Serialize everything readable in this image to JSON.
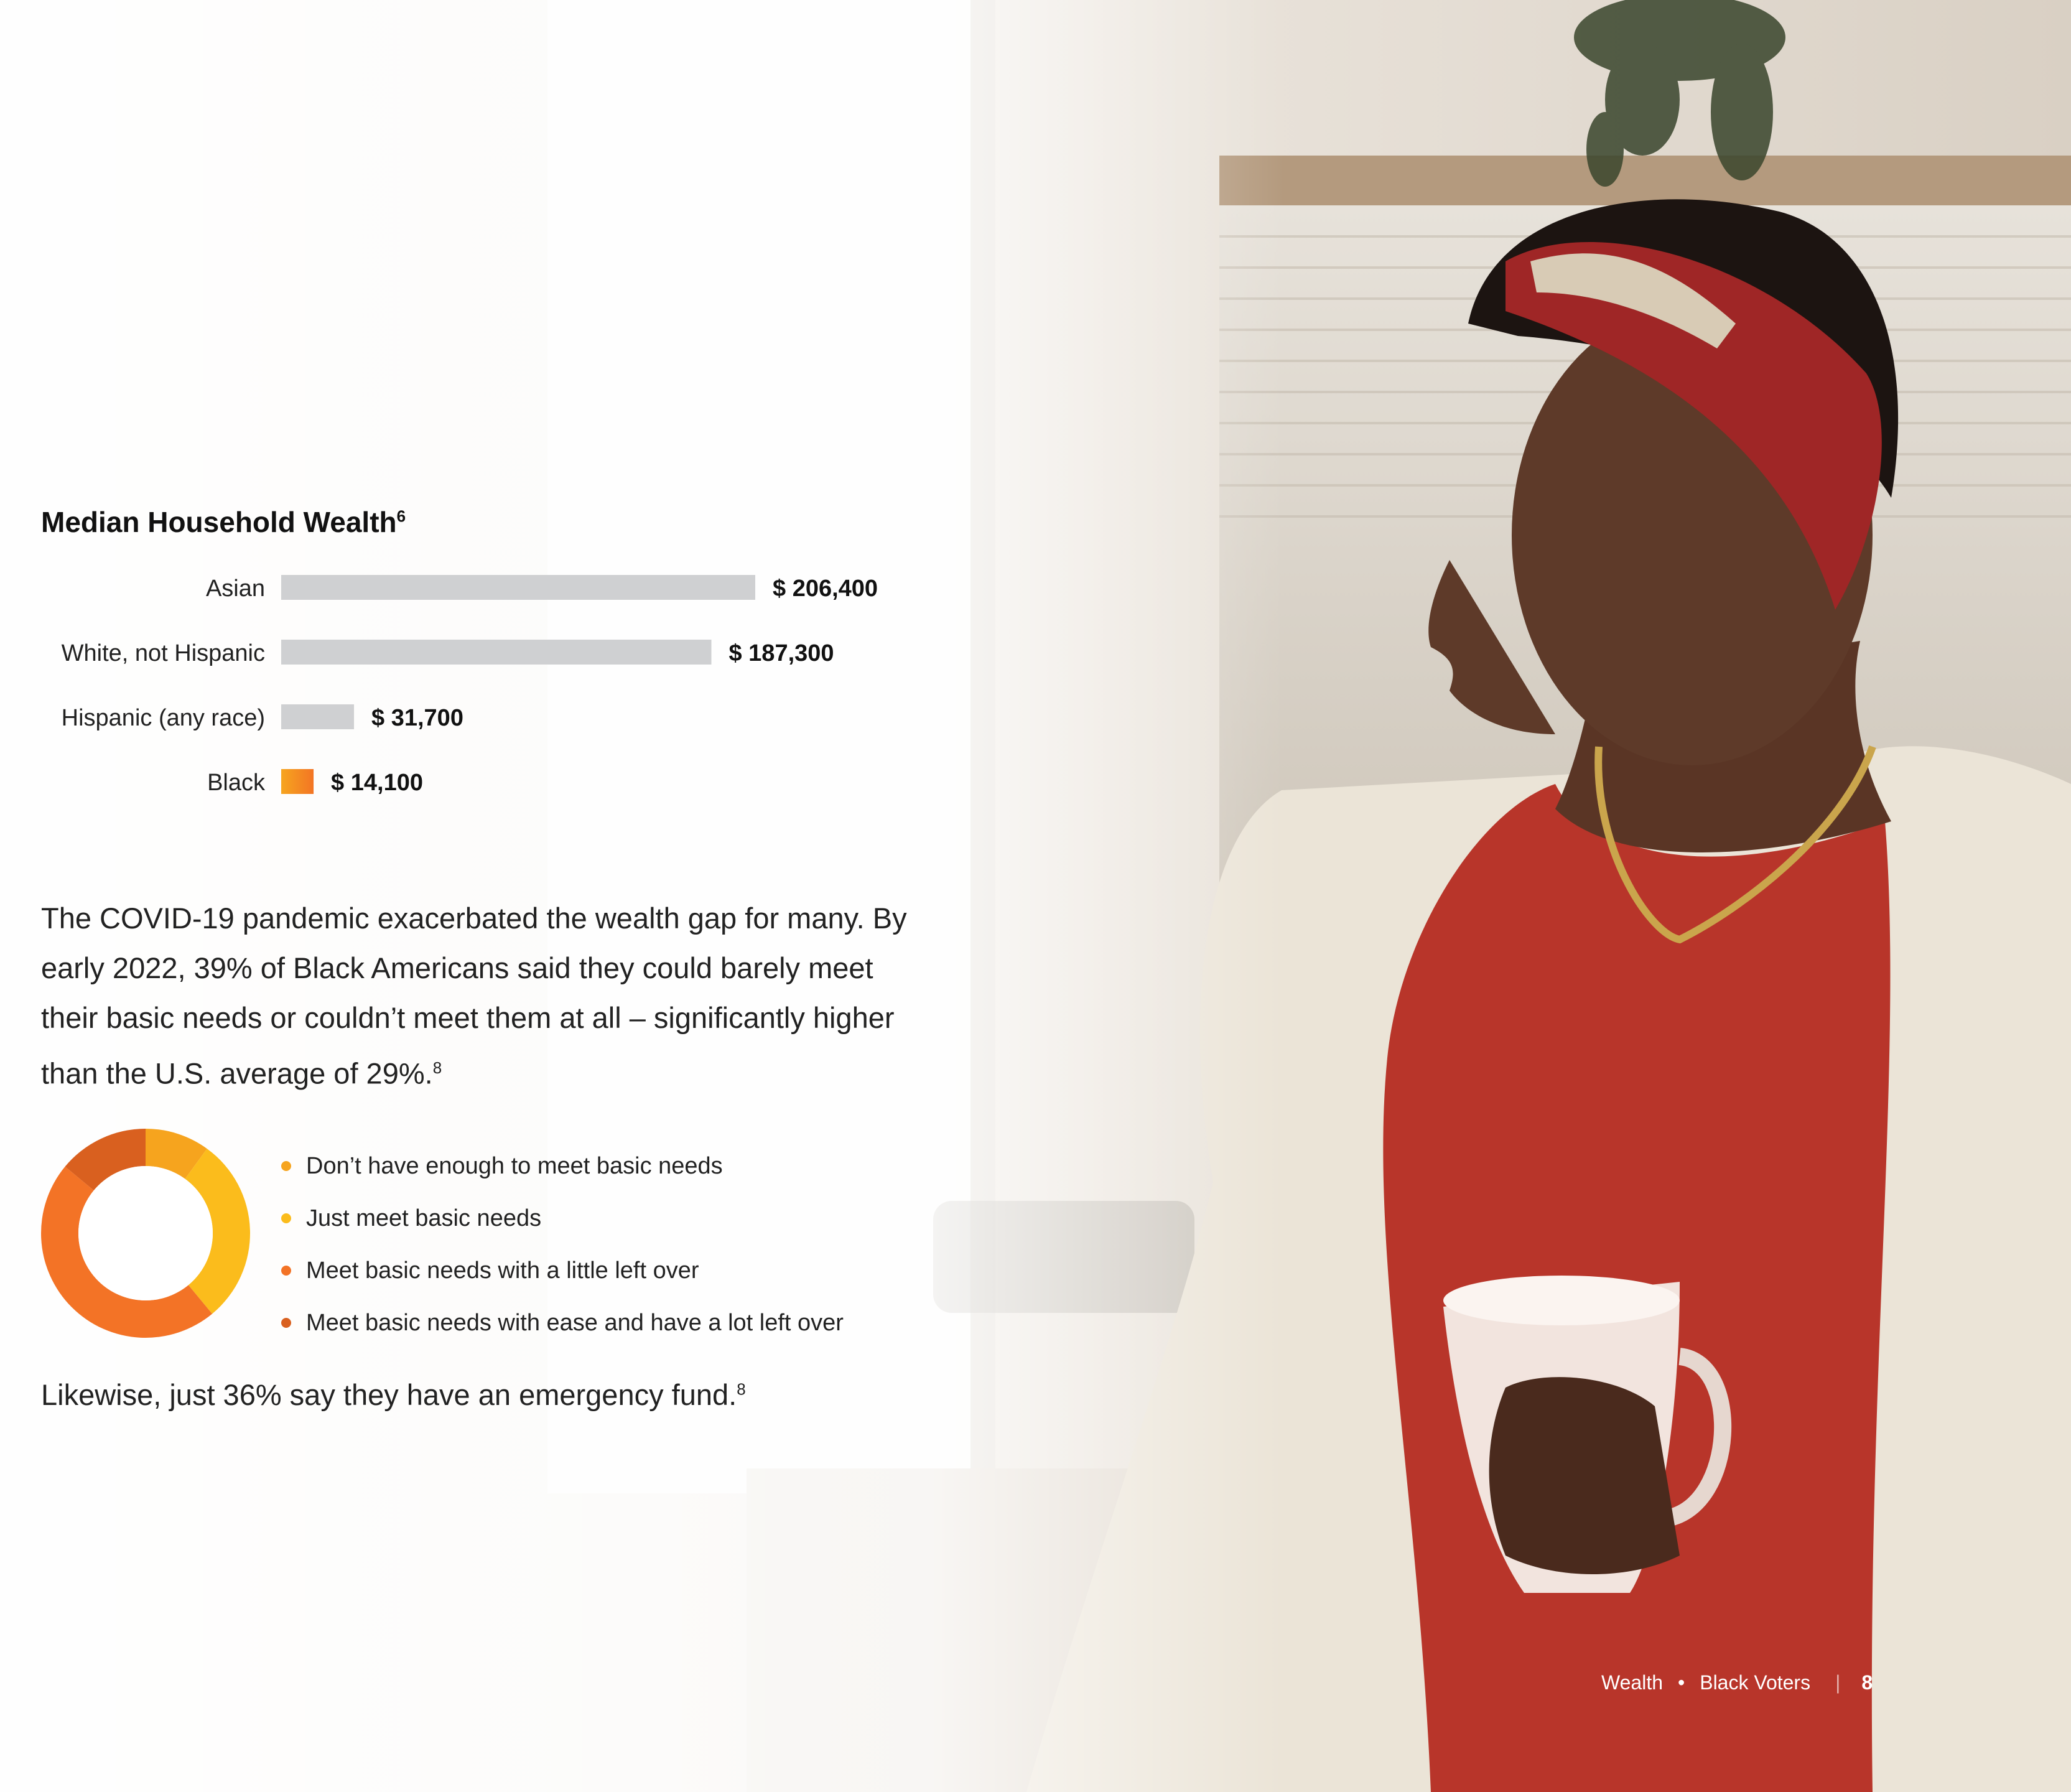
{
  "colors": {
    "bar_gray": "#cfd0d2",
    "bar_highlight_start": "#f6a51f",
    "bar_highlight_end": "#f37524",
    "donut_1": "#f6a41e",
    "donut_2": "#fbbc1c",
    "donut_3": "#f37326",
    "donut_4": "#d9601f"
  },
  "chart_data": {
    "type": "bar",
    "orientation": "horizontal",
    "title": "Median Household Wealth",
    "title_footnote": "6",
    "categories": [
      "Asian",
      "White, not Hispanic",
      "Hispanic (any race)",
      "Black"
    ],
    "values": [
      206400,
      187300,
      31700,
      14100
    ],
    "value_labels": [
      "$ 206,400",
      "$ 187,300",
      "$ 31,700",
      "$ 14,100"
    ],
    "highlight": "Black",
    "xlim": [
      0,
      206400
    ]
  },
  "body": {
    "paragraph1": "The COVID-19 pandemic exacerbated the wealth gap for many. By early 2022, 39% of Black Americans said they could barely meet their basic needs or couldn’t meet them at all – significantly higher than the U.S. average of 29%.",
    "paragraph1_footnote": "8",
    "paragraph2": "Likewise, just 36% say they have an emergency fund.",
    "paragraph2_footnote": "8"
  },
  "donut_chart": {
    "type": "pie",
    "legend": [
      "Don’t have enough to meet basic needs",
      "Just meet basic needs",
      "Meet basic needs with a little left over",
      "Meet basic needs with ease and have a lot left over"
    ],
    "values": [
      10,
      29,
      47,
      14
    ]
  },
  "footer": {
    "section": "Wealth",
    "bullet": "•",
    "topic": "Black Voters",
    "divider": "|",
    "page": "8"
  }
}
